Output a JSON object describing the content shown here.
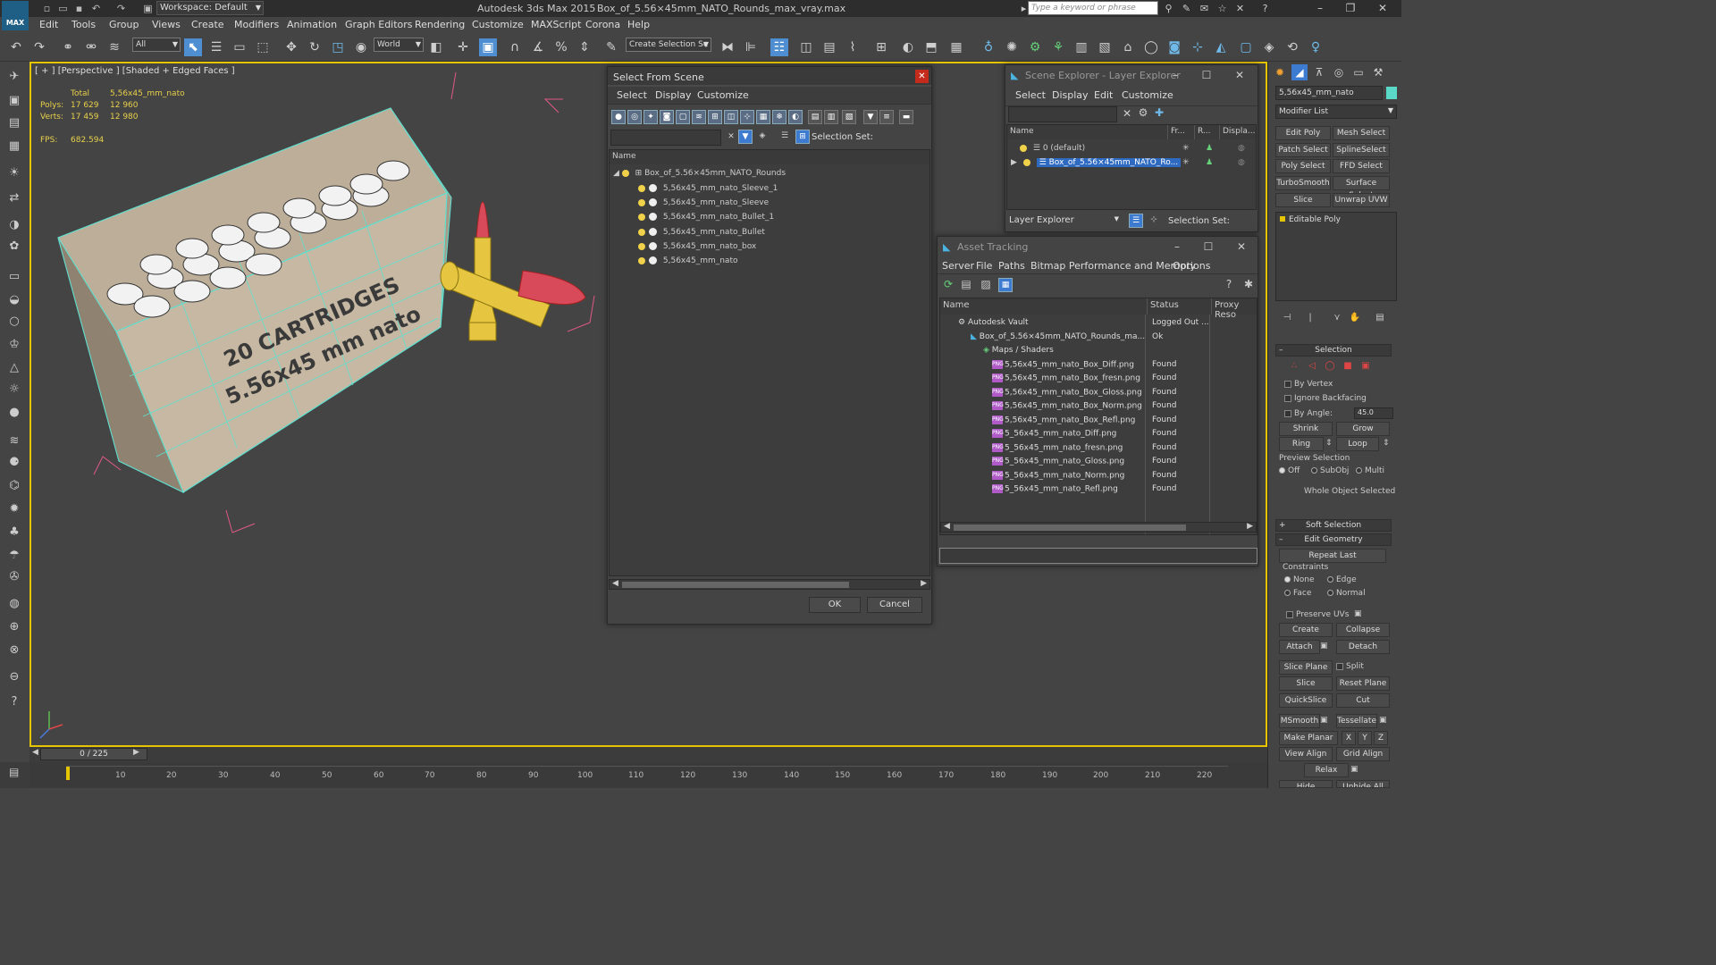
{
  "titlebar": {
    "app_logo": "MAX",
    "workspace": "Workspace: Default",
    "app_title": "Autodesk 3ds Max  2015",
    "file_title": "Box_of_5.56×45mm_NATO_Rounds_max_vray.max",
    "search_placeholder": "Type a keyword or phrase"
  },
  "menu": [
    "Edit",
    "Tools",
    "Group",
    "Views",
    "Create",
    "Modifiers",
    "Animation",
    "Graph Editors",
    "Rendering",
    "Customize",
    "MAXScript",
    "Corona",
    "Help"
  ],
  "toolbar": {
    "filter": "All",
    "coord_system": "World",
    "selection_set": "Create Selection Se"
  },
  "viewport": {
    "label": "[ + ] [Perspective ] [Shaded + Edged Faces ]",
    "stats": {
      "total_label": "Total",
      "object_name": "5,56x45_mm_nato",
      "polys_label": "Polys:",
      "polys_total": "17 629",
      "polys_obj": "12 960",
      "verts_label": "Verts:",
      "verts_total": "17 459",
      "verts_obj": "12 980",
      "fps_label": "FPS:",
      "fps_value": "682.594"
    },
    "box_text_line1": "20 CARTRIDGES",
    "box_text_line2": "5.56x45 mm nato"
  },
  "select_from_scene": {
    "title": "Select From Scene",
    "menus": [
      "Select",
      "Display",
      "Customize"
    ],
    "selection_set_label": "Selection Set:",
    "column_name": "Name",
    "root": "Box_of_5.56×45mm_NATO_Rounds",
    "items": [
      "5,56x45_mm_nato_Sleeve_1",
      "5,56x45_mm_nato_Sleeve",
      "5,56x45_mm_nato_Bullet_1",
      "5,56x45_mm_nato_Bullet",
      "5,56x45_mm_nato_box",
      "5,56x45_mm_nato"
    ],
    "ok": "OK",
    "cancel": "Cancel"
  },
  "scene_explorer": {
    "title": "Scene Explorer - Layer Explorer",
    "menus": [
      "Select",
      "Display",
      "Edit",
      "Customize"
    ],
    "columns": [
      "Name",
      "Fr...",
      "R...",
      "Displa..."
    ],
    "rows": [
      "0 (default)",
      "Box_of_5.56×45mm_NATO_Ro..."
    ],
    "footer_dropdown": "Layer Explorer",
    "selection_set_label": "Selection Set:"
  },
  "asset_tracking": {
    "title": "Asset Tracking",
    "menus": [
      "Server",
      "File",
      "Paths",
      "Bitmap Performance and Memory",
      "Options"
    ],
    "columns": [
      "Name",
      "Status",
      "Proxy Reso"
    ],
    "vault": {
      "name": "Autodesk Vault",
      "status": "Logged Out ..."
    },
    "file": {
      "name": "Box_of_5.56×45mm_NATO_Rounds_ma...",
      "status": "Ok"
    },
    "maps_group": "Maps / Shaders",
    "png_badge": "PNG",
    "maps": [
      {
        "name": "5,56x45_mm_nato_Box_Diff.png",
        "status": "Found"
      },
      {
        "name": "5,56x45_mm_nato_Box_fresn.png",
        "status": "Found"
      },
      {
        "name": "5,56x45_mm_nato_Box_Gloss.png",
        "status": "Found"
      },
      {
        "name": "5,56x45_mm_nato_Box_Norm.png",
        "status": "Found"
      },
      {
        "name": "5,56x45_mm_nato_Box_Refl.png",
        "status": "Found"
      },
      {
        "name": "5_56x45_mm_nato_Diff.png",
        "status": "Found"
      },
      {
        "name": "5_56x45_mm_nato_fresn.png",
        "status": "Found"
      },
      {
        "name": "5_56x45_mm_nato_Gloss.png",
        "status": "Found"
      },
      {
        "name": "5_56x45_mm_nato_Norm.png",
        "status": "Found"
      },
      {
        "name": "5_56x45_mm_nato_Refl.png",
        "status": "Found"
      }
    ]
  },
  "command_panel": {
    "object_name": "5,56x45_mm_nato",
    "modifier_list": "Modifier List",
    "modifier_buttons": [
      "Edit Poly",
      "Mesh Select",
      "Patch Select",
      "SplineSelect",
      "Poly Select",
      "FFD Select",
      "TurboSmooth",
      "Surface Select",
      "Slice",
      "Unwrap UVW"
    ],
    "stack_item": "Editable Poly",
    "selection_rollout": "Selection",
    "by_vertex": "By Vertex",
    "ignore_backfacing": "Ignore Backfacing",
    "by_angle": "By Angle:",
    "by_angle_value": "45.0",
    "shrink": "Shrink",
    "grow": "Grow",
    "ring": "Ring",
    "loop": "Loop",
    "preview_selection": "Preview Selection",
    "preview_off": "Off",
    "preview_subobj": "SubObj",
    "preview_multi": "Multi",
    "whole_object": "Whole Object Selected",
    "soft_selection": "Soft Selection",
    "edit_geometry": "Edit Geometry",
    "repeat_last": "Repeat Last",
    "constraints": "Constraints",
    "c_none": "None",
    "c_edge": "Edge",
    "c_face": "Face",
    "c_normal": "Normal",
    "preserve_uvs": "Preserve UVs",
    "create": "Create",
    "collapse": "Collapse",
    "attach": "Attach",
    "detach": "Detach",
    "slice_plane": "Slice Plane",
    "split": "Split",
    "slice": "Slice",
    "reset_plane": "Reset Plane",
    "quickslice": "QuickSlice",
    "cut": "Cut",
    "msmooth": "MSmooth",
    "tessellate": "Tessellate",
    "make_planar": "Make Planar",
    "x": "X",
    "y": "Y",
    "z": "Z",
    "view_align": "View Align",
    "grid_align": "Grid Align",
    "relax": "Relax",
    "hide_selected": "Hide Selected",
    "unhide_all": "Unhide All"
  },
  "timeline": {
    "slider": "0 / 225",
    "ticks": [
      "10",
      "20",
      "30",
      "40",
      "50",
      "60",
      "70",
      "80",
      "90",
      "100",
      "110",
      "120",
      "130",
      "140",
      "150",
      "160",
      "170",
      "180",
      "190",
      "200",
      "210",
      "220"
    ]
  }
}
